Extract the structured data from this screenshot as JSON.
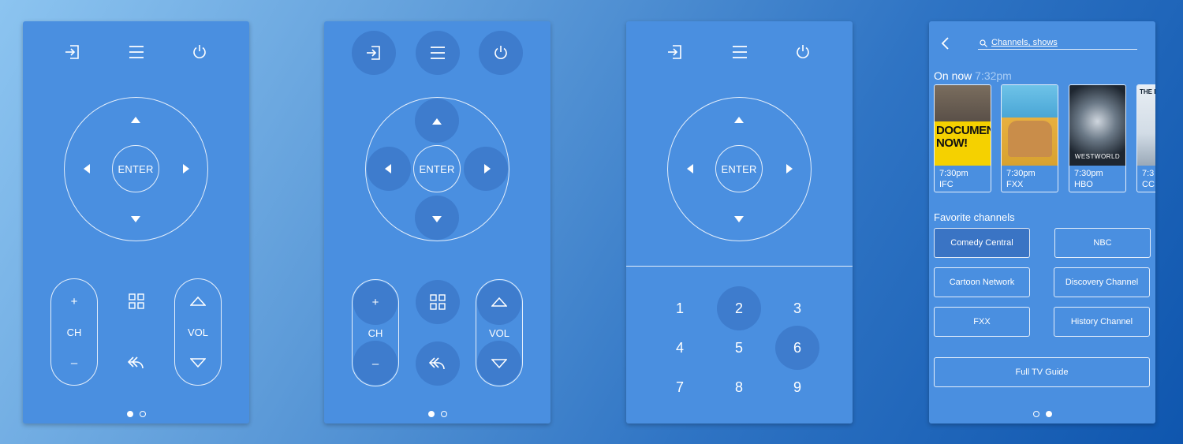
{
  "remote": {
    "enter_label": "ENTER",
    "ch_label": "CH",
    "vol_label": "VOL",
    "ch_plus": "+",
    "ch_minus": "–"
  },
  "icons": {
    "input": "input-icon",
    "menu": "menu-icon",
    "power": "power-icon",
    "apps": "apps-grid-icon",
    "back": "back-icon"
  },
  "keypad": {
    "keys": [
      "1",
      "2",
      "3",
      "4",
      "5",
      "6",
      "7",
      "8",
      "9"
    ]
  },
  "guide": {
    "search_placeholder": "Channels, shows",
    "on_now_label": "On now",
    "on_now_time": "7:32pm",
    "posters": [
      {
        "time": "7:30pm",
        "channel": "IFC",
        "art_text": "DOCUMENTARY NOW!"
      },
      {
        "time": "7:30pm",
        "channel": "FXX",
        "art_text": ""
      },
      {
        "time": "7:30pm",
        "channel": "HBO",
        "art_text": "WESTWORLD"
      },
      {
        "time": "7:3",
        "channel": "CC",
        "art_text": "THE DAI"
      }
    ],
    "favorites_label": "Favorite channels",
    "favorites": [
      "Comedy Central",
      "NBC",
      "Cartoon Network",
      "Discovery Channel",
      "FXX",
      "History Channel"
    ],
    "full_guide_label": "Full TV Guide"
  },
  "colors": {
    "panel": "#4a8fe0",
    "active": "#3a74c4"
  }
}
